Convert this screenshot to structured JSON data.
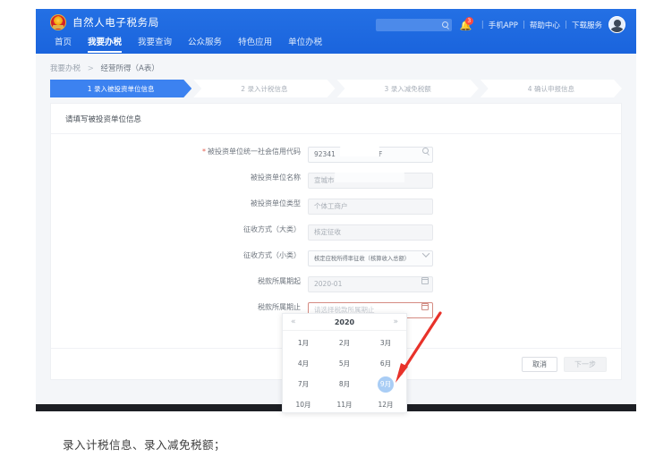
{
  "header": {
    "brand_title": "自然人电子税务局",
    "emblem_icon": "national-emblem-icon",
    "search_placeholder": "",
    "search_icon": "search-icon",
    "bell_icon": "bell-icon",
    "notification_count": "3",
    "links": [
      {
        "label": "手机APP"
      },
      {
        "label": "帮助中心"
      },
      {
        "label": "下载服务"
      }
    ],
    "separator": "|",
    "avatar_icon": "user-avatar",
    "nav": [
      {
        "label": "首页",
        "active": false
      },
      {
        "label": "我要办税",
        "active": true
      },
      {
        "label": "我要查询",
        "active": false
      },
      {
        "label": "公众服务",
        "active": false
      },
      {
        "label": "特色应用",
        "active": false
      },
      {
        "label": "单位办税",
        "active": false
      }
    ],
    "brand_color": "#1d68e0"
  },
  "breadcrumb": {
    "parent": "我要办税",
    "separator": ">",
    "current": "经营所得（A表）"
  },
  "steps": [
    {
      "label": "1 录入被投资单位信息",
      "active": true
    },
    {
      "label": "2 录入计税信息",
      "active": false
    },
    {
      "label": "3 录入减免税额",
      "active": false
    },
    {
      "label": "4 确认申报信息",
      "active": false
    }
  ],
  "card": {
    "title": "请填写被投资单位信息",
    "fields": [
      {
        "label": "被投资单位统一社会信用代码",
        "required": true,
        "value": "92341            G9L8F",
        "placeholder": "",
        "icon": "search-icon",
        "state": "editable"
      },
      {
        "label": "被投资单位名称",
        "required": false,
        "value": "宣城市",
        "placeholder": "",
        "icon": "none",
        "state": "readonly"
      },
      {
        "label": "被投资单位类型",
        "required": false,
        "value": "个体工商户",
        "placeholder": "",
        "icon": "none",
        "state": "readonly"
      },
      {
        "label": "征收方式（大类）",
        "required": false,
        "value": "核定征收",
        "placeholder": "",
        "icon": "none",
        "state": "readonly"
      },
      {
        "label": "征收方式（小类）",
        "required": false,
        "value": "核定应税所得率征收（核算收入总额）",
        "placeholder": "",
        "icon": "chevron-down-icon",
        "state": "select"
      },
      {
        "label": "税款所属期起",
        "required": false,
        "value": "2020-01",
        "placeholder": "",
        "icon": "calendar-icon",
        "state": "readonly"
      },
      {
        "label": "税款所属期止",
        "required": false,
        "value": "",
        "placeholder": "请选择税款所属期止",
        "icon": "calendar-icon",
        "state": "error"
      }
    ],
    "buttons": {
      "cancel": "取消",
      "next": "下一步"
    }
  },
  "datepicker": {
    "prev_icon": "«",
    "next_icon": "»",
    "year": "2020",
    "months": [
      "1月",
      "2月",
      "3月",
      "4月",
      "5月",
      "6月",
      "7月",
      "8月",
      "9月",
      "10月",
      "11月",
      "12月"
    ],
    "selected_month": "9月",
    "selected_color": "#a9cdf5"
  },
  "annotation": {
    "arrow_icon": "red-arrow-icon",
    "arrow_color": "#e8322a"
  },
  "caption": "录入计税信息、录入减免税额；"
}
